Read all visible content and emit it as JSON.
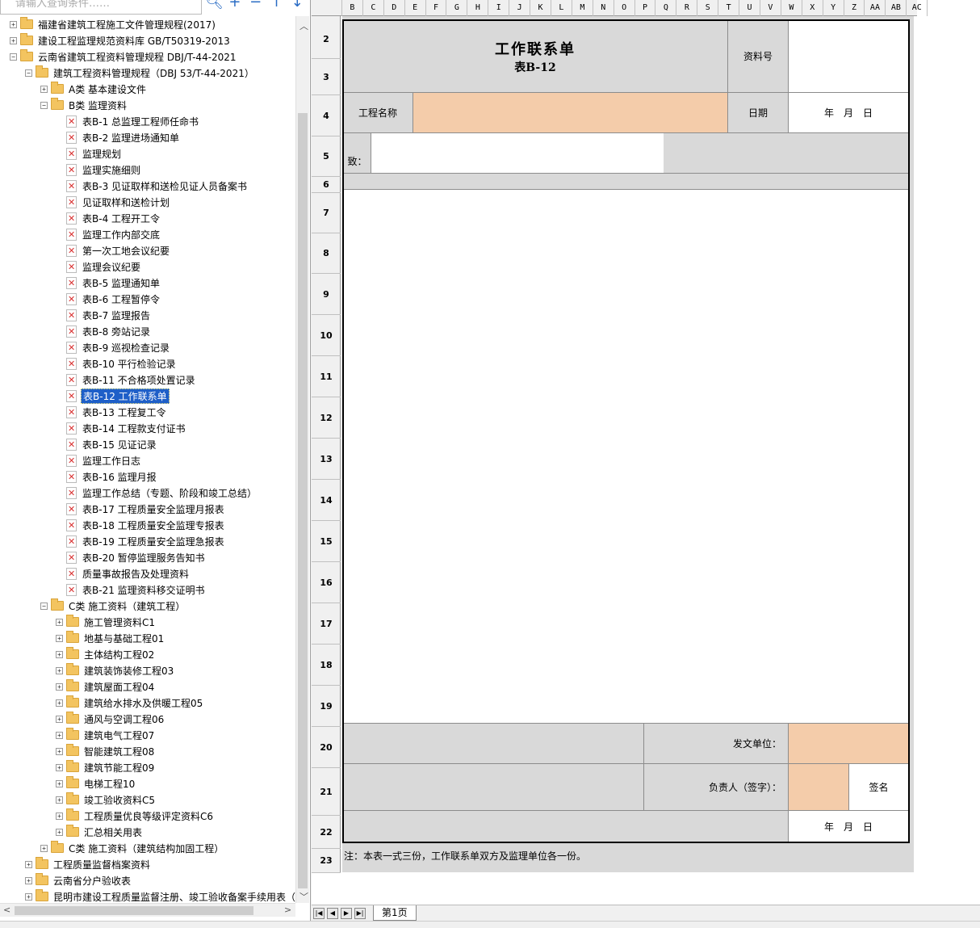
{
  "search": {
    "placeholder": "请输入查询条件……",
    "tools": [
      "search-icon",
      "plus-icon",
      "minus-icon",
      "arrow-up-icon",
      "arrow-down-icon"
    ]
  },
  "tree": [
    {
      "lv": 0,
      "exp": "+",
      "type": "folder",
      "label": "福建省建筑工程施工文件管理规程(2017)"
    },
    {
      "lv": 0,
      "exp": "+",
      "type": "folder",
      "label": "建设工程监理规范资料库 GB/T50319-2013"
    },
    {
      "lv": 0,
      "exp": "-",
      "type": "folder",
      "label": "云南省建筑工程资料管理规程 DBJ/T-44-2021"
    },
    {
      "lv": 1,
      "exp": "-",
      "type": "folder",
      "label": "建筑工程资料管理规程（DBJ 53/T-44-2021）"
    },
    {
      "lv": 2,
      "exp": "+",
      "type": "folder",
      "label": "A类 基本建设文件"
    },
    {
      "lv": 2,
      "exp": "-",
      "type": "folder",
      "label": "B类 监理资料"
    },
    {
      "lv": 3,
      "type": "file",
      "label": "表B-1 总监理工程师任命书"
    },
    {
      "lv": 3,
      "type": "file",
      "label": "表B-2 监理进场通知单"
    },
    {
      "lv": 3,
      "type": "file",
      "label": "监理规划"
    },
    {
      "lv": 3,
      "type": "file",
      "label": "监理实施细则"
    },
    {
      "lv": 3,
      "type": "file",
      "label": "表B-3 见证取样和送检见证人员备案书"
    },
    {
      "lv": 3,
      "type": "file",
      "label": "见证取样和送检计划"
    },
    {
      "lv": 3,
      "type": "file",
      "label": "表B-4 工程开工令"
    },
    {
      "lv": 3,
      "type": "file",
      "label": "监理工作内部交底"
    },
    {
      "lv": 3,
      "type": "file",
      "label": "第一次工地会议纪要"
    },
    {
      "lv": 3,
      "type": "file",
      "label": "监理会议纪要"
    },
    {
      "lv": 3,
      "type": "file",
      "label": "表B-5 监理通知单"
    },
    {
      "lv": 3,
      "type": "file",
      "label": "表B-6 工程暂停令"
    },
    {
      "lv": 3,
      "type": "file",
      "label": "表B-7 监理报告"
    },
    {
      "lv": 3,
      "type": "file",
      "label": "表B-8 旁站记录"
    },
    {
      "lv": 3,
      "type": "file",
      "label": "表B-9 巡视检查记录"
    },
    {
      "lv": 3,
      "type": "file",
      "label": "表B-10 平行检验记录"
    },
    {
      "lv": 3,
      "type": "file",
      "label": "表B-11 不合格项处置记录"
    },
    {
      "lv": 3,
      "type": "file",
      "label": "表B-12 工作联系单",
      "sel": true
    },
    {
      "lv": 3,
      "type": "file",
      "label": "表B-13 工程复工令"
    },
    {
      "lv": 3,
      "type": "file",
      "label": "表B-14 工程款支付证书"
    },
    {
      "lv": 3,
      "type": "file",
      "label": "表B-15 见证记录"
    },
    {
      "lv": 3,
      "type": "file",
      "label": "监理工作日志"
    },
    {
      "lv": 3,
      "type": "file",
      "label": "表B-16 监理月报"
    },
    {
      "lv": 3,
      "type": "file",
      "label": "监理工作总结（专题、阶段和竣工总结）"
    },
    {
      "lv": 3,
      "type": "file",
      "label": "表B-17 工程质量安全监理月报表"
    },
    {
      "lv": 3,
      "type": "file",
      "label": "表B-18 工程质量安全监理专报表"
    },
    {
      "lv": 3,
      "type": "file",
      "label": "表B-19 工程质量安全监理急报表"
    },
    {
      "lv": 3,
      "type": "file",
      "label": "表B-20 暂停监理服务告知书"
    },
    {
      "lv": 3,
      "type": "file",
      "label": "质量事故报告及处理资料"
    },
    {
      "lv": 3,
      "type": "file",
      "label": "表B-21 监理资料移交证明书"
    },
    {
      "lv": 2,
      "exp": "-",
      "type": "folder",
      "label": "C类 施工资料（建筑工程）"
    },
    {
      "lv": 3,
      "exp": "+",
      "type": "folder",
      "label": "施工管理资料C1"
    },
    {
      "lv": 3,
      "exp": "+",
      "type": "folder",
      "label": "地基与基础工程01"
    },
    {
      "lv": 3,
      "exp": "+",
      "type": "folder",
      "label": "主体结构工程02"
    },
    {
      "lv": 3,
      "exp": "+",
      "type": "folder",
      "label": "建筑装饰装修工程03"
    },
    {
      "lv": 3,
      "exp": "+",
      "type": "folder",
      "label": "建筑屋面工程04"
    },
    {
      "lv": 3,
      "exp": "+",
      "type": "folder",
      "label": "建筑给水排水及供暖工程05"
    },
    {
      "lv": 3,
      "exp": "+",
      "type": "folder",
      "label": "通风与空调工程06"
    },
    {
      "lv": 3,
      "exp": "+",
      "type": "folder",
      "label": "建筑电气工程07"
    },
    {
      "lv": 3,
      "exp": "+",
      "type": "folder",
      "label": "智能建筑工程08"
    },
    {
      "lv": 3,
      "exp": "+",
      "type": "folder",
      "label": "建筑节能工程09"
    },
    {
      "lv": 3,
      "exp": "+",
      "type": "folder",
      "label": "电梯工程10"
    },
    {
      "lv": 3,
      "exp": "+",
      "type": "folder",
      "label": "竣工验收资料C5"
    },
    {
      "lv": 3,
      "exp": "+",
      "type": "folder",
      "label": "工程质量优良等级评定资料C6"
    },
    {
      "lv": 3,
      "exp": "+",
      "type": "folder",
      "label": "汇总相关用表"
    },
    {
      "lv": 2,
      "exp": "+",
      "type": "folder",
      "label": "C类 施工资料（建筑结构加固工程）"
    },
    {
      "lv": 1,
      "exp": "+",
      "type": "folder",
      "label": "工程质量监督档案资料"
    },
    {
      "lv": 1,
      "exp": "+",
      "type": "folder",
      "label": "云南省分户验收表"
    },
    {
      "lv": 1,
      "exp": "+",
      "type": "folder",
      "label": "昆明市建设工程质量监督注册、竣工验收备案手续用表（"
    }
  ],
  "columns": [
    "B",
    "C",
    "D",
    "E",
    "F",
    "G",
    "H",
    "I",
    "J",
    "K",
    "L",
    "M",
    "N",
    "O",
    "P",
    "Q",
    "R",
    "S",
    "T",
    "U",
    "V",
    "W",
    "X",
    "Y",
    "Z",
    "AA",
    "AB",
    "AC"
  ],
  "rows": [
    "2",
    "3",
    "4",
    "5",
    "6",
    "7",
    "8",
    "9",
    "10",
    "11",
    "12",
    "13",
    "14",
    "15",
    "16",
    "17",
    "18",
    "19",
    "20",
    "21",
    "22",
    "23"
  ],
  "form": {
    "title": "工作联系单",
    "subtitle": "表B-12",
    "doc_no_label": "资料号",
    "project_label": "工程名称",
    "date_label": "日期",
    "date_value": "年　月　日",
    "to_label": "致：",
    "issuer_label": "发文单位：",
    "owner_label": "负责人（签字）：",
    "sign_label": "签名",
    "bottom_date": "年　月　日",
    "note": "注：本表一式三份，工作联系单双方及监理单位各一份。"
  },
  "sheet": {
    "tab": "第1页"
  },
  "colors": {
    "peach": "#f4ccaa",
    "gray": "#d9d9d9",
    "selection": "#1e5fc8"
  }
}
